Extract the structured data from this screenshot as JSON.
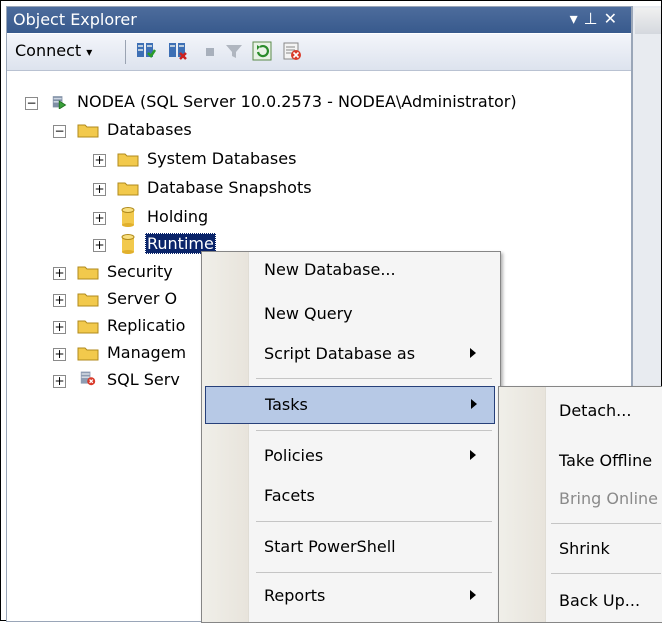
{
  "window": {
    "title": "Object Explorer",
    "controls": "▾ ⊥ ✕"
  },
  "toolbar": {
    "connect_label": "Connect",
    "connect_arrow": "▾",
    "icons": [
      "register-servers-icon",
      "disconnect-icon",
      "stop-icon",
      "filter-icon",
      "refresh-icon",
      "activity-icon"
    ]
  },
  "tree": {
    "server": "NODEA (SQL Server 10.0.2573 - NODEA\\Administrator)",
    "databases": "Databases",
    "system_databases": "System Databases",
    "database_snapshots": "Database Snapshots",
    "holding": "Holding",
    "runtime": "Runtime",
    "security": "Security",
    "server_objects": "Server O",
    "replication": "Replicatio",
    "management": "Managem",
    "sql_server_agent": "SQL Serv",
    "expand_symbol": "+",
    "collapse_symbol": "−"
  },
  "context_menu": {
    "new_database": "New Database...",
    "new_query": "New Query",
    "script_database_as": "Script Database as",
    "tasks": "Tasks",
    "policies": "Policies",
    "facets": "Facets",
    "start_powershell": "Start PowerShell",
    "reports": "Reports"
  },
  "tasks_submenu": {
    "detach": "Detach...",
    "take_offline": "Take Offline",
    "bring_online": "Bring Online",
    "shrink": "Shrink",
    "back_up": "Back Up..."
  }
}
